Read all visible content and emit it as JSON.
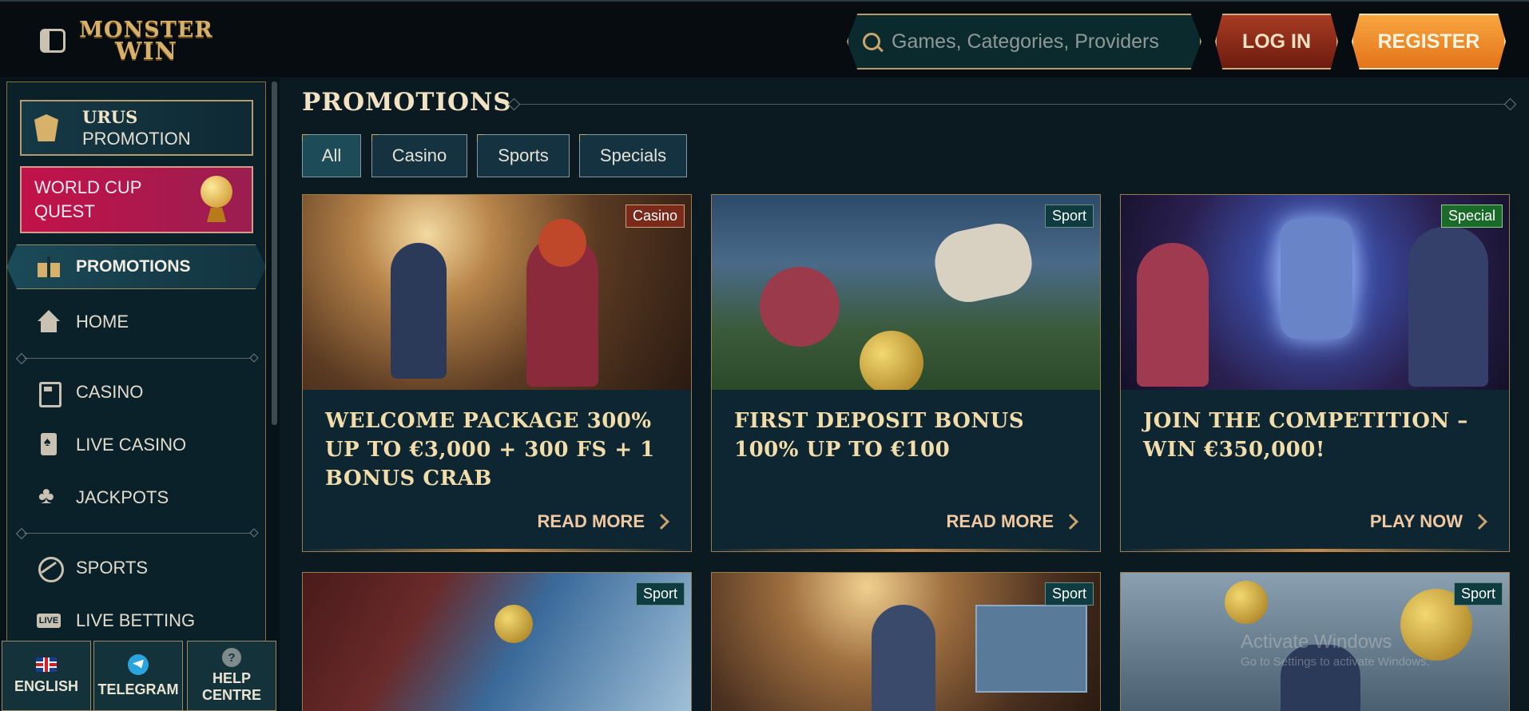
{
  "header": {
    "logo": {
      "line1": "MONSTER",
      "line2": "WIN"
    },
    "search_placeholder": "Games, Categories, Providers",
    "login_label": "LOG IN",
    "register_label": "REGISTER"
  },
  "sidebar": {
    "urus": {
      "title": "URUS",
      "subtitle": "PROMOTION"
    },
    "worldcup": {
      "line1": "WORLD CUP",
      "line2": "QUEST"
    },
    "active_item": "PROMOTIONS",
    "items": [
      {
        "label": "HOME",
        "icon": "home-icon"
      },
      {
        "label": "CASINO",
        "icon": "slot-machine-icon"
      },
      {
        "label": "LIVE CASINO",
        "icon": "playing-card-icon"
      },
      {
        "label": "JACKPOTS",
        "icon": "clover-icon"
      },
      {
        "label": "SPORTS",
        "icon": "sports-ball-icon"
      },
      {
        "label": "LIVE BETTING",
        "icon": "live-icon"
      }
    ],
    "footer": {
      "language": "ENGLISH",
      "telegram": "TELEGRAM",
      "help_line1": "HELP",
      "help_line2": "CENTRE"
    }
  },
  "main": {
    "title": "PROMOTIONS",
    "filters": [
      "All",
      "Casino",
      "Sports",
      "Specials"
    ],
    "active_filter": "All",
    "cards": [
      {
        "tag": "Casino",
        "title": "WELCOME PACKAGE 300% UP TO €3,000 + 300 FS + 1 BONUS CRAB",
        "action": "READ MORE"
      },
      {
        "tag": "Sport",
        "title": "FIRST DEPOSIT BONUS 100% UP TO €100",
        "action": "READ MORE"
      },
      {
        "tag": "Special",
        "title": "JOIN THE COMPETITION – WIN €350,000!",
        "action": "PLAY NOW"
      },
      {
        "tag": "Sport"
      },
      {
        "tag": "Sport"
      },
      {
        "tag": "Sport"
      }
    ]
  },
  "watermark": {
    "line1": "Activate Windows",
    "line2": "Go to Settings to activate Windows."
  },
  "colors": {
    "accent_gold": "#d7b06a",
    "login_red": "#a83b22",
    "register_orange": "#f29a35",
    "worldcup_pink": "#c2124a",
    "background": "#0b1a21"
  }
}
